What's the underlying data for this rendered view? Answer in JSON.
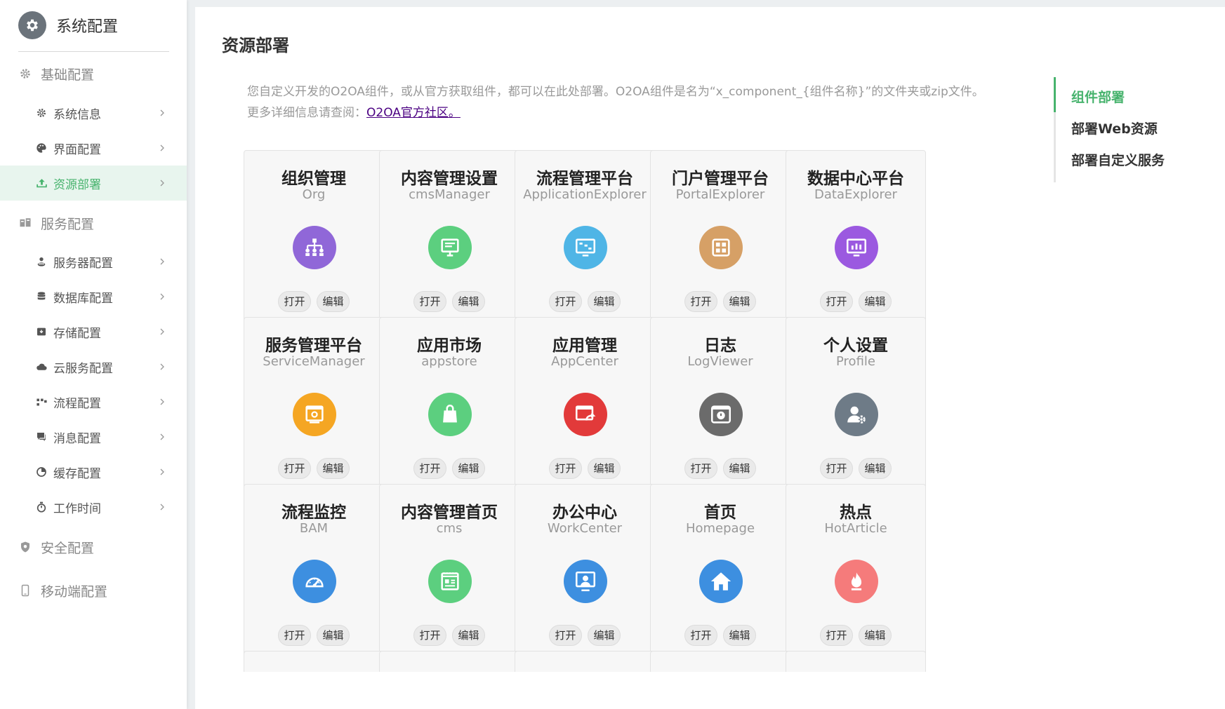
{
  "sidebar": {
    "title": "系统配置",
    "groups": [
      {
        "label": "基础配置",
        "icon": "gear-icon"
      },
      {
        "label": "服务配置",
        "icon": "server-icon"
      },
      {
        "label": "安全配置",
        "icon": "shield-icon"
      },
      {
        "label": "移动端配置",
        "icon": "mobile-icon"
      }
    ],
    "items": [
      {
        "label": "系统信息",
        "icon": "gear-icon"
      },
      {
        "label": "界面配置",
        "icon": "palette-icon"
      },
      {
        "label": "资源部署",
        "icon": "upload-icon",
        "active": true
      },
      {
        "label": "服务器配置",
        "icon": "user-server-icon"
      },
      {
        "label": "数据库配置",
        "icon": "database-icon"
      },
      {
        "label": "存储配置",
        "icon": "storage-icon"
      },
      {
        "label": "云服务配置",
        "icon": "cloud-icon"
      },
      {
        "label": "流程配置",
        "icon": "flow-icon"
      },
      {
        "label": "消息配置",
        "icon": "message-icon"
      },
      {
        "label": "缓存配置",
        "icon": "pie-icon"
      },
      {
        "label": "工作时间",
        "icon": "stopwatch-icon"
      }
    ]
  },
  "main": {
    "title": "资源部署",
    "desc_line1": "您自定义开发的O2OA组件，或从官方获取组件，都可以在此处部署。O2OA组件是名为“x_component_{组件名称}”的文件夹或zip文件。",
    "desc_line2_prefix": "更多详细信息请查阅：",
    "desc_link": "O2OA官方社区。",
    "anchors": [
      "组件部署",
      "部署Web资源",
      "部署自定义服务"
    ],
    "open_label": "打开",
    "edit_label": "编辑",
    "cards": [
      {
        "name": "组织管理",
        "en": "Org",
        "color": "#9067d8",
        "icon": "org-icon"
      },
      {
        "name": "内容管理设置",
        "en": "cmsManager",
        "color": "#5ccf7f",
        "icon": "cms-manager-icon"
      },
      {
        "name": "流程管理平台",
        "en": "ApplicationExplorer",
        "color": "#4fb5e6",
        "icon": "flow-platform-icon"
      },
      {
        "name": "门户管理平台",
        "en": "PortalExplorer",
        "color": "#d6a066",
        "icon": "portal-icon"
      },
      {
        "name": "数据中心平台",
        "en": "DataExplorer",
        "color": "#9b59e0",
        "icon": "data-center-icon"
      },
      {
        "name": "服务管理平台",
        "en": "ServiceManager",
        "color": "#f5a623",
        "icon": "service-manager-icon"
      },
      {
        "name": "应用市场",
        "en": "appstore",
        "color": "#5ccf7f",
        "icon": "shopping-bag-icon"
      },
      {
        "name": "应用管理",
        "en": "AppCenter",
        "color": "#e23a3a",
        "icon": "app-center-icon"
      },
      {
        "name": "日志",
        "en": "LogViewer",
        "color": "#6b6b6b",
        "icon": "log-icon"
      },
      {
        "name": "个人设置",
        "en": "Profile",
        "color": "#6e7b87",
        "icon": "profile-icon"
      },
      {
        "name": "流程监控",
        "en": "BAM",
        "color": "#3d8fe0",
        "icon": "speedometer-icon"
      },
      {
        "name": "内容管理首页",
        "en": "cms",
        "color": "#5ccf7f",
        "icon": "newspaper-icon"
      },
      {
        "name": "办公中心",
        "en": "WorkCenter",
        "color": "#3d8fe0",
        "icon": "workcenter-icon"
      },
      {
        "name": "首页",
        "en": "Homepage",
        "color": "#3d8fe0",
        "icon": "home-icon"
      },
      {
        "name": "热点",
        "en": "HotArticle",
        "color": "#f57b7b",
        "icon": "fire-icon"
      }
    ]
  }
}
